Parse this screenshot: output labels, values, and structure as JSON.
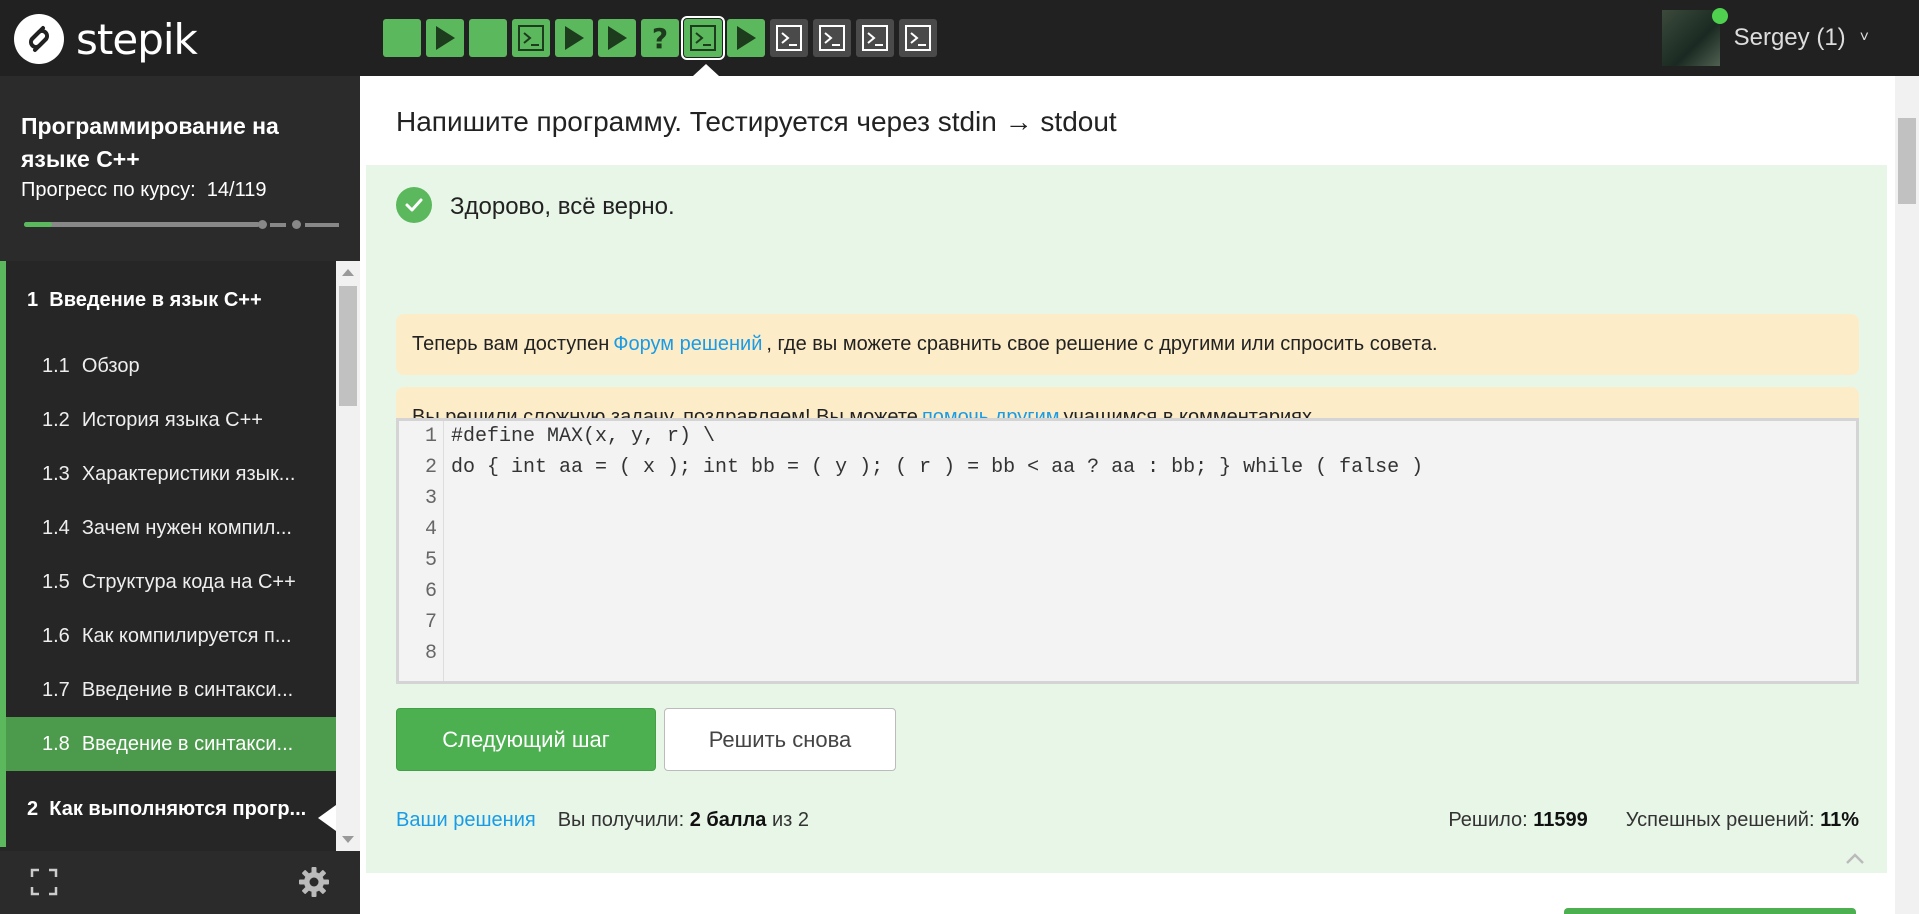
{
  "header": {
    "logo_text": "stepik",
    "user_name": "Sergey (1)",
    "user_chevron": "˅",
    "steps": [
      {
        "kind": "text-done",
        "color": "#5cb85c"
      },
      {
        "kind": "play-done",
        "color": "#5cb85c"
      },
      {
        "kind": "text-done",
        "color": "#5cb85c"
      },
      {
        "kind": "code-done",
        "color": "#5cb85c"
      },
      {
        "kind": "play-done",
        "color": "#5cb85c"
      },
      {
        "kind": "play-done",
        "color": "#5cb85c"
      },
      {
        "kind": "quiz-done",
        "color": "#5cb85c",
        "glyph": "?"
      },
      {
        "kind": "code-current",
        "color": "#5cb85c"
      },
      {
        "kind": "play-done",
        "color": "#5cb85c"
      },
      {
        "kind": "code-todo",
        "color": "#4a4a4a"
      },
      {
        "kind": "code-todo",
        "color": "#4a4a4a"
      },
      {
        "kind": "code-todo",
        "color": "#4a4a4a"
      },
      {
        "kind": "code-todo",
        "color": "#4a4a4a"
      }
    ]
  },
  "sidebar": {
    "course_title": "Программирование на языке C++",
    "progress_label": "Прогресс по курсу:",
    "progress_value": "14/119",
    "progress_fraction": 0.118,
    "modules": [
      {
        "number": "1",
        "title": "Введение в язык C++",
        "lessons": [
          {
            "number": "1.1",
            "title": "Обзор"
          },
          {
            "number": "1.2",
            "title": "История языка C++"
          },
          {
            "number": "1.3",
            "title": "Характеристики язык..."
          },
          {
            "number": "1.4",
            "title": "Зачем нужен компил..."
          },
          {
            "number": "1.5",
            "title": "Структура кода на C++"
          },
          {
            "number": "1.6",
            "title": "Как компилируется п..."
          },
          {
            "number": "1.7",
            "title": "Введение в синтакси..."
          },
          {
            "number": "1.8",
            "title": "Введение в синтакси..."
          }
        ]
      },
      {
        "number": "2",
        "title": "Как выполняются прогр..."
      }
    ]
  },
  "main": {
    "heading": "Напишите программу. Тестируется через stdin → stdout",
    "success_text": "Здорово, всё верно.",
    "notice1": {
      "before": "Теперь вам доступен",
      "link": "Форум решений",
      "after": ", где вы можете сравнить свое решение с другими или спросить совета."
    },
    "notice2": {
      "before": "Вы решили сложную задачу, поздравляем! Вы можете",
      "link": "помочь другим",
      "after": "учащимся в комментариях."
    },
    "code_lines": [
      "#define MAX(x, y, r) \\",
      "do { int aa = ( x ); int bb = ( y ); ( r ) = bb < aa ? aa : bb; } while ( false )",
      "",
      "",
      "",
      "",
      "",
      ""
    ],
    "line_numbers": [
      "1",
      "2",
      "3",
      "4",
      "5",
      "6",
      "7",
      "8"
    ],
    "next_button": "Следующий шаг",
    "retry_button": "Решить снова",
    "footer": {
      "your_solutions": "Ваши решения",
      "score_prefix": "Вы получили:",
      "score_value": "2 балла",
      "score_suffix": "из 2",
      "solved_label": "Решило:",
      "solved_value": "11599",
      "success_label": "Успешных решений:",
      "success_value": "11%"
    }
  },
  "colors": {
    "accent_green": "#5cb85c",
    "link_blue": "#1a9be6",
    "notice_bg": "#fdecc8",
    "success_bg": "#e8f6e8"
  }
}
